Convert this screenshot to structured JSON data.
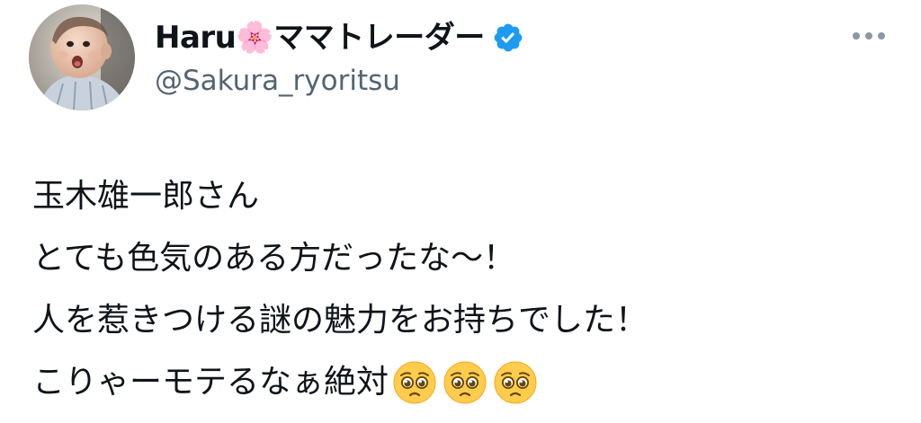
{
  "tweet": {
    "author": {
      "display_name": "Haru🌸ママトレーダー",
      "handle": "@Sakura_ryoritsu",
      "verified": true,
      "avatar": "baby-photo",
      "verified_color": "#1d9bf0"
    },
    "text_lines": [
      "玉木雄一郎さん",
      "とても色気のある方だったな〜！",
      "人を惹きつける謎の魅力をお持ちでした！",
      "こりゃーモテるなぁ絶対"
    ],
    "trailing_emojis": [
      "pleading-face-icon",
      "pleading-face-icon",
      "pleading-face-icon"
    ],
    "more_icon": "more-horizontal-icon"
  },
  "colors": {
    "text": "#0f1419",
    "handle": "#536471",
    "verified": "#1d9bf0",
    "more_dots": "#8b98a5"
  }
}
